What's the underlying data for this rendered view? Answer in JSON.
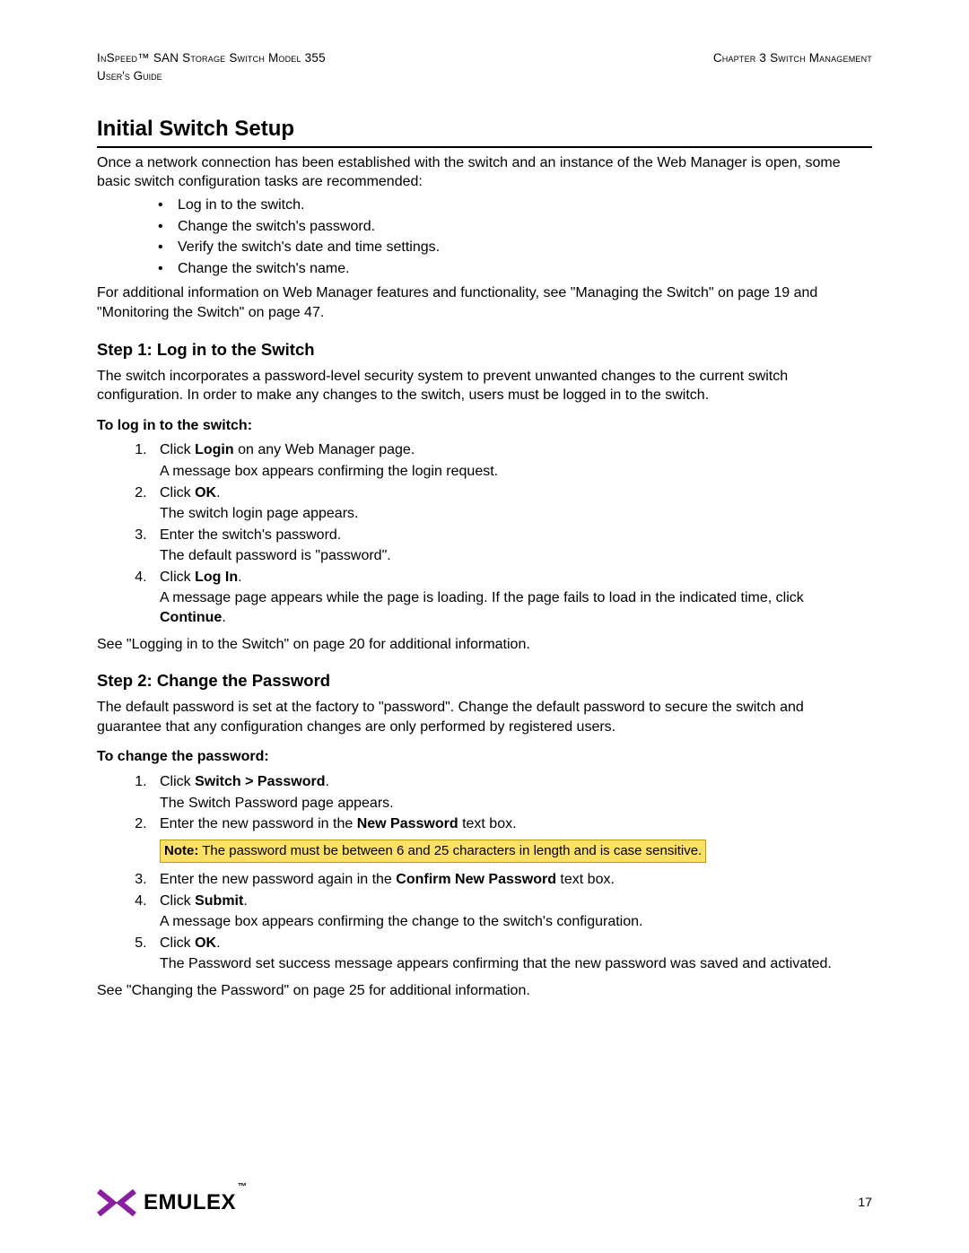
{
  "header": {
    "left_line1": "InSpeed™ SAN Storage Switch Model 355",
    "left_line2": "User's Guide",
    "right_line1": "Chapter 3 Switch Management"
  },
  "main_title": "Initial Switch Setup",
  "intro": "Once a network connection has been established with the switch and an instance of the Web Manager is open, some basic switch configuration tasks are recommended:",
  "bullets": [
    "Log in to the switch.",
    "Change the switch's password.",
    "Verify the switch's date and time settings.",
    "Change the switch's name."
  ],
  "for_additional": "For additional information on Web Manager features and functionality, see \"Managing the Switch\" on page 19 and \"Monitoring the Switch\" on page 47.",
  "step1": {
    "title": "Step 1: Log in to the Switch",
    "desc": "The switch incorporates a password-level security system to prevent unwanted changes to the current switch configuration. In order to make any changes to the switch, users must be logged in to the switch.",
    "lead": "To log in to the switch:",
    "items": {
      "i1_pre": "Click ",
      "i1_b": "Login",
      "i1_post": " on any Web Manager page.",
      "i1_sub": "A message box appears confirming the login request.",
      "i2_pre": "Click ",
      "i2_b": "OK",
      "i2_post": ".",
      "i2_sub": "The switch login page appears.",
      "i3_main": "Enter the switch's password.",
      "i3_sub": "The default password is \"password\".",
      "i4_pre": "Click ",
      "i4_b": "Log In",
      "i4_post": ".",
      "i4_sub_pre": "A message page appears while the page is loading. If the page fails to load in the indicated time, click ",
      "i4_sub_b": "Continue",
      "i4_sub_post": "."
    },
    "see": "See \"Logging in to the Switch\" on page 20 for additional information."
  },
  "step2": {
    "title": "Step 2: Change the Password",
    "desc": "The default password is set at the factory to \"password\". Change the default password to secure the switch and guarantee that any configuration changes are only performed by registered users.",
    "lead": "To change the password:",
    "items": {
      "i1_pre": "Click ",
      "i1_b": "Switch > Password",
      "i1_post": ".",
      "i1_sub": "The Switch Password page appears.",
      "i2_pre": "Enter the new password in the ",
      "i2_b": "New Password",
      "i2_post": " text box.",
      "note_b": "Note:",
      "note_rest": " The password must be between 6 and 25 characters in length and is case sensitive.",
      "i3_pre": "Enter the new password again in the ",
      "i3_b": "Confirm New Password",
      "i3_post": " text box.",
      "i4_pre": "Click ",
      "i4_b": "Submit",
      "i4_post": ".",
      "i4_sub": "A message box appears confirming the change to the switch's configuration.",
      "i5_pre": "Click ",
      "i5_b": "OK",
      "i5_post": ".",
      "i5_sub": "The Password set success message appears confirming that the new password was saved and activated."
    },
    "see": "See \"Changing the Password\" on page 25 for additional information."
  },
  "footer": {
    "brand": "EMULEX",
    "tm": "™",
    "page_number": "17"
  }
}
